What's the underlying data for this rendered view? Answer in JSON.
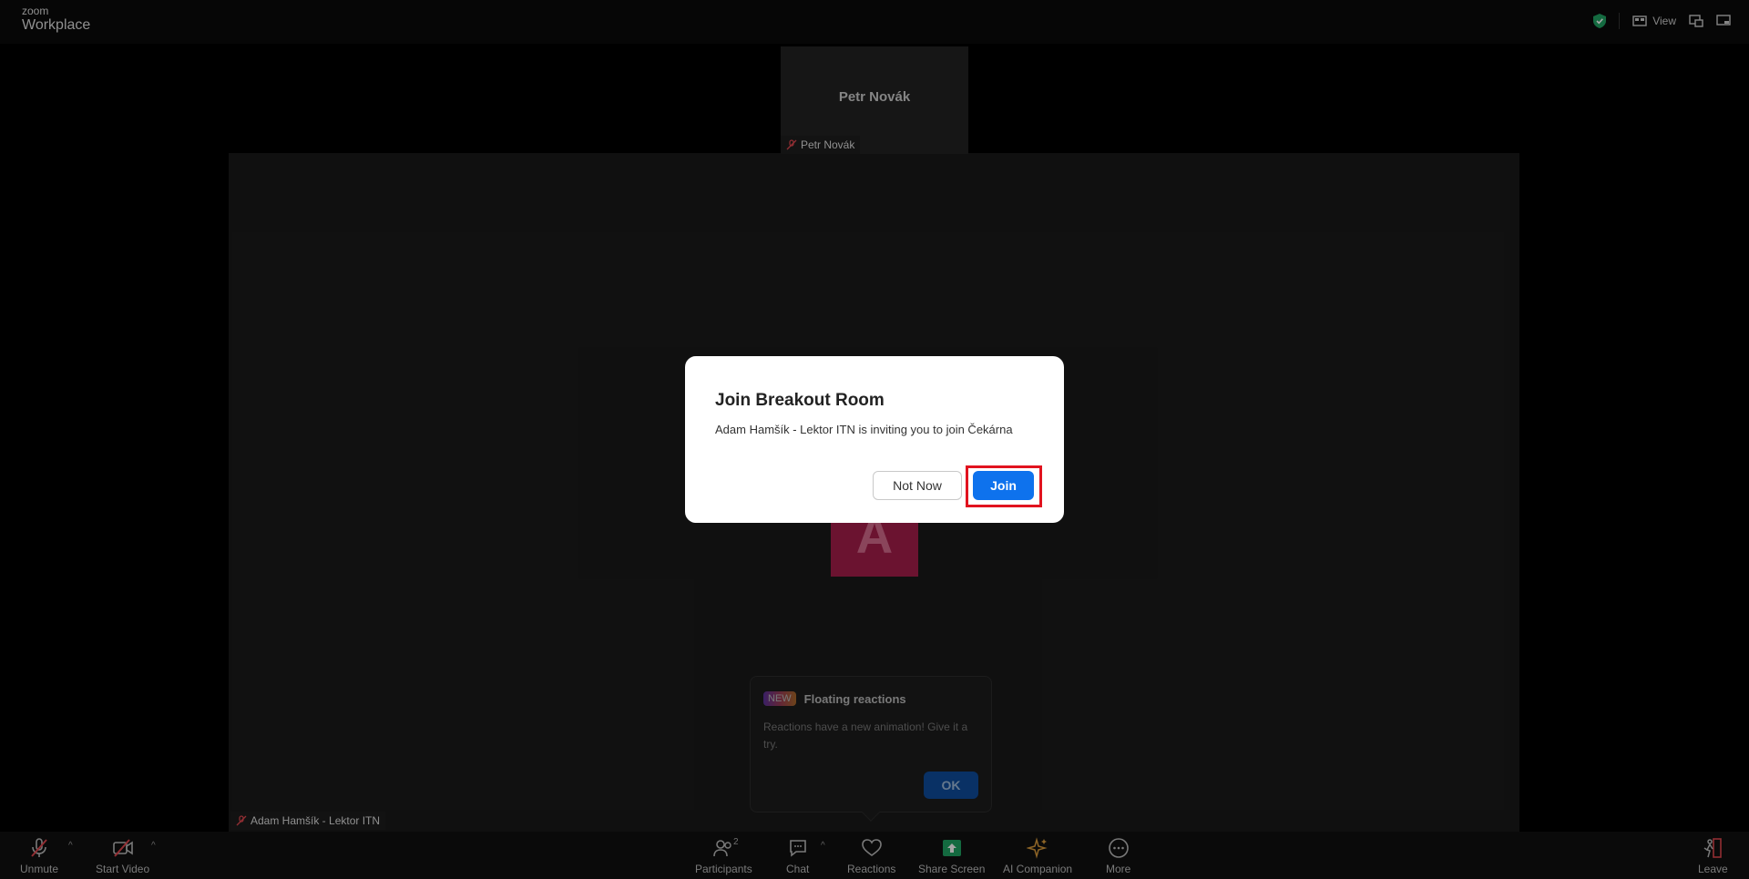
{
  "app": {
    "logo_small": "zoom",
    "logo_big": "Workplace"
  },
  "topbar": {
    "view_label": "View"
  },
  "thumbnail": {
    "display_name": "Petr Novák",
    "tag_name": "Petr Novák"
  },
  "main_video": {
    "avatar_letter": "A",
    "tag_name": "Adam Hamšík - Lektor ITN"
  },
  "dialog": {
    "title": "Join Breakout Room",
    "message": "Adam Hamšík - Lektor ITN is inviting you to join Čekárna",
    "not_now_label": "Not Now",
    "join_label": "Join"
  },
  "tip": {
    "badge": "NEW",
    "title": "Floating reactions",
    "body": "Reactions have a new animation! Give it a try.",
    "ok_label": "OK"
  },
  "toolbar": {
    "unmute": "Unmute",
    "start_video": "Start Video",
    "participants": "Participants",
    "participants_count": "2",
    "chat": "Chat",
    "reactions": "Reactions",
    "share_screen": "Share Screen",
    "ai_companion": "AI Companion",
    "more": "More",
    "leave": "Leave"
  },
  "colors": {
    "join": "#0e72ed",
    "highlight": "#e1131f",
    "avatar": "#a51e4b",
    "share": "#1fa463"
  },
  "icons": [
    "shield-check-icon",
    "view-icon",
    "minimize-icon",
    "exit-fullscreen-icon",
    "mic-muted-icon",
    "video-off-icon",
    "participants-icon",
    "chat-icon",
    "heart-icon",
    "share-screen-icon",
    "sparkle-icon",
    "more-icon",
    "leave-icon"
  ]
}
